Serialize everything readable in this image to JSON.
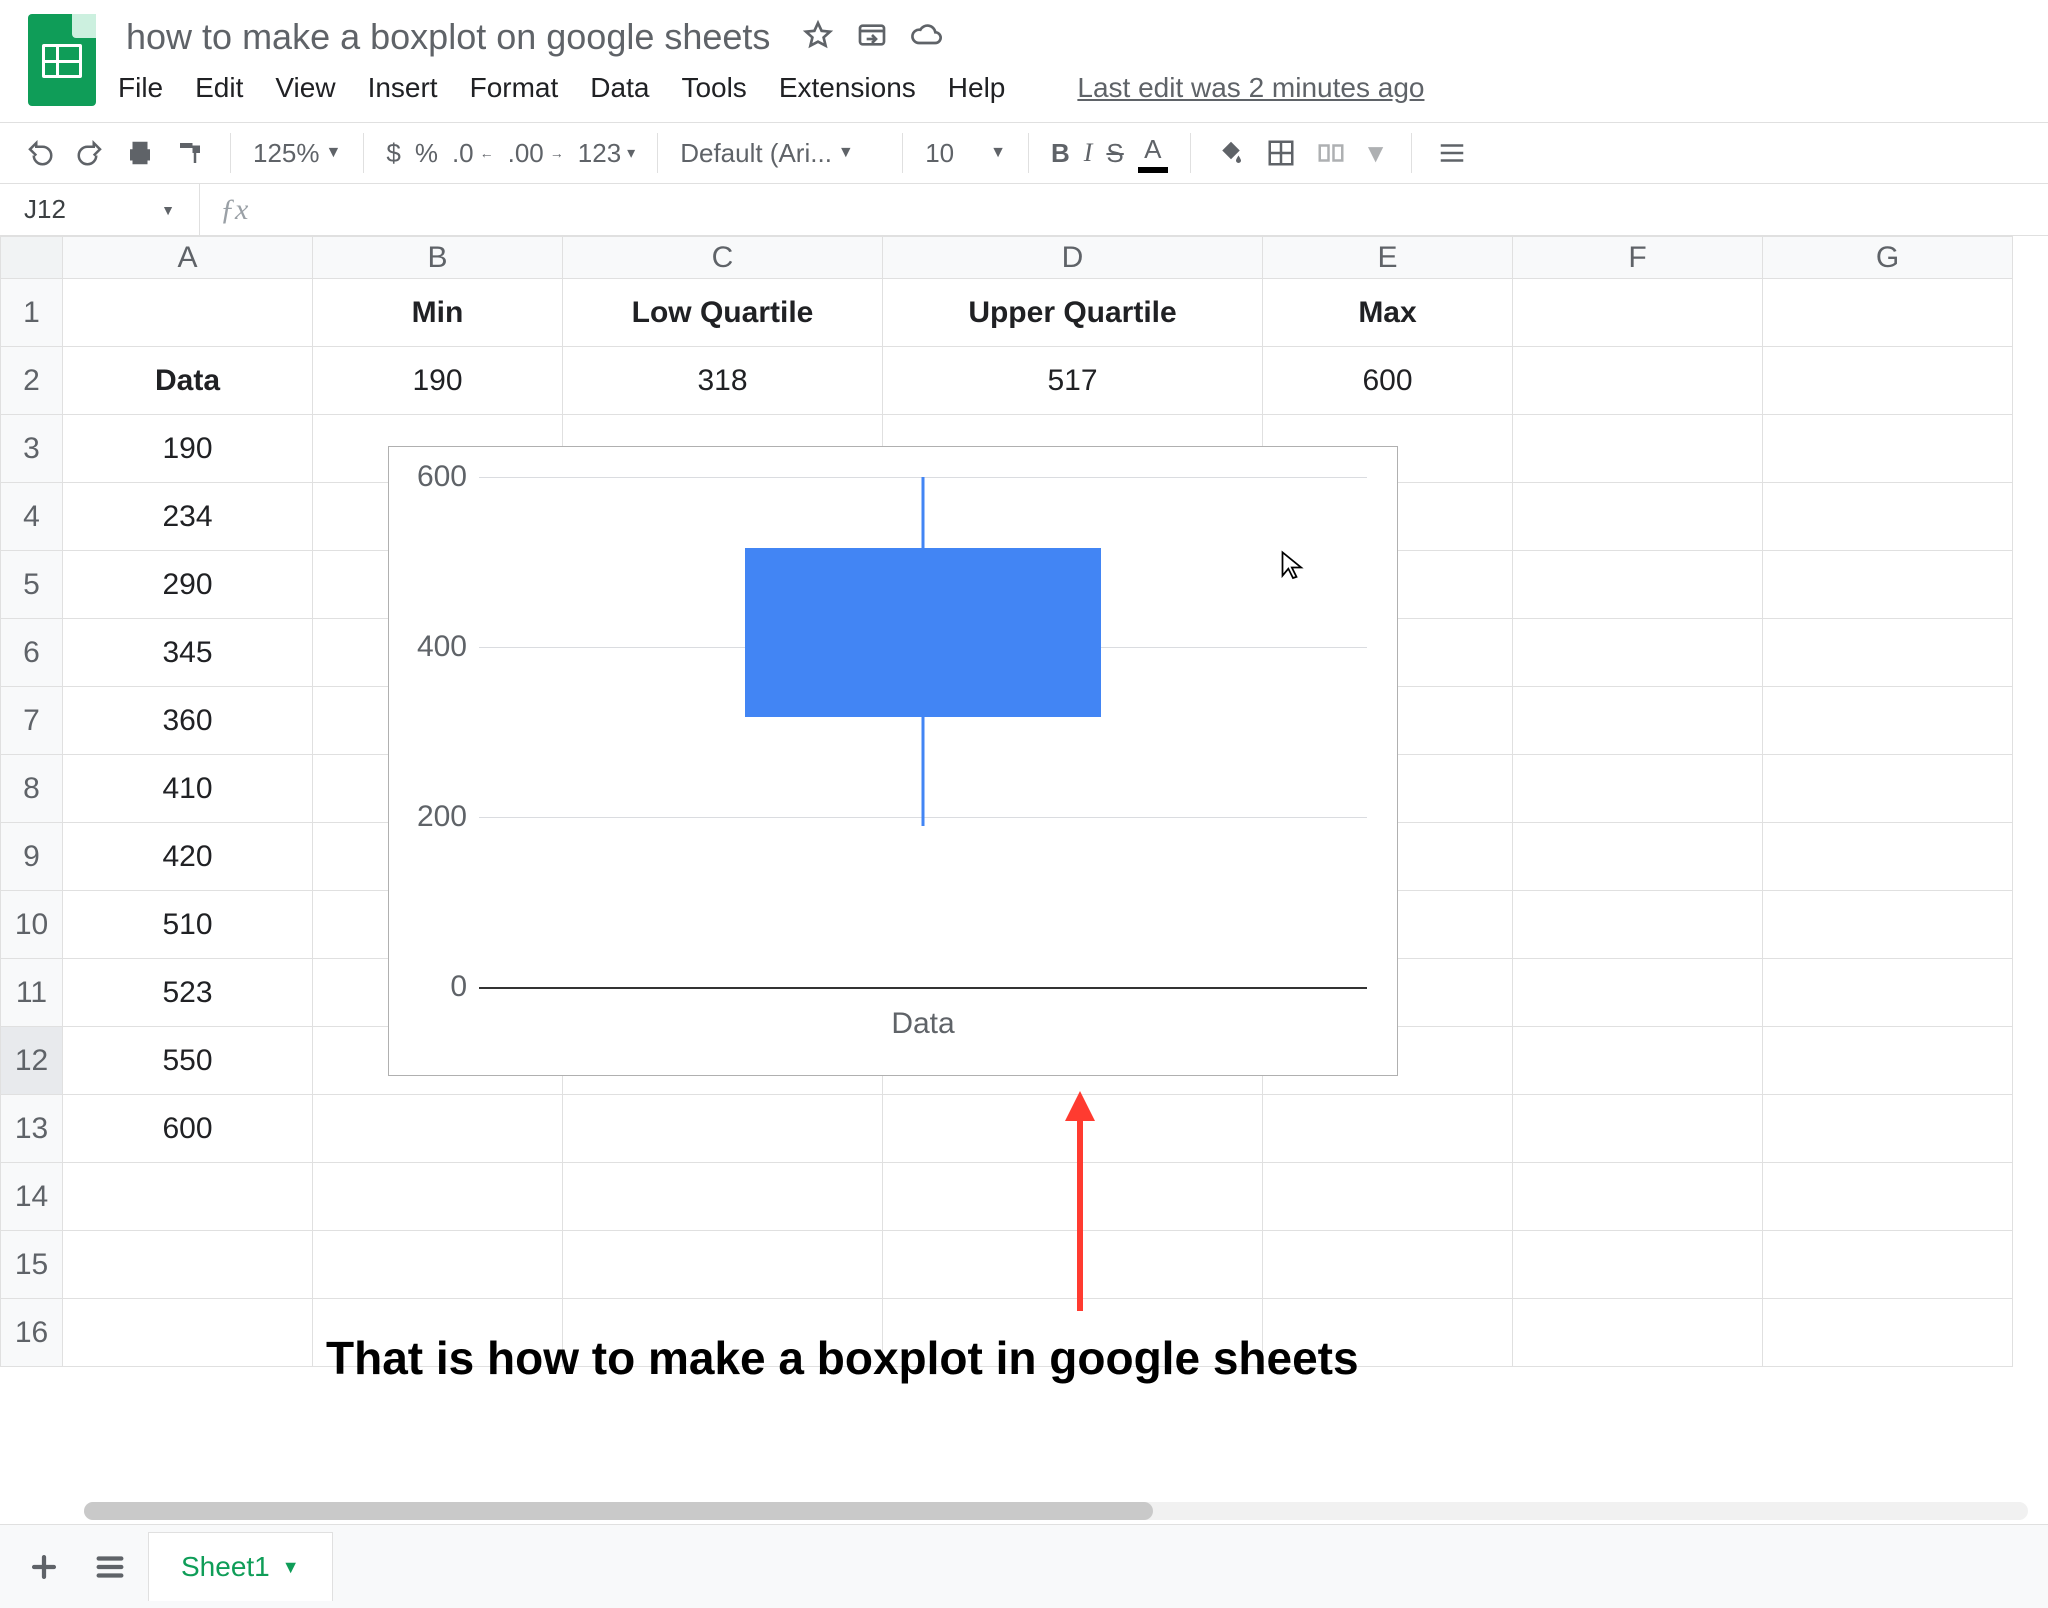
{
  "doc": {
    "title": "how to make a boxplot on google sheets",
    "last_edit": "Last edit was 2 minutes ago"
  },
  "menu": {
    "file": "File",
    "edit": "Edit",
    "view": "View",
    "insert": "Insert",
    "format": "Format",
    "data": "Data",
    "tools": "Tools",
    "extensions": "Extensions",
    "help": "Help"
  },
  "toolbar": {
    "zoom": "125%",
    "currency": "$",
    "percent": "%",
    "dec_dec": ".0",
    "dec_inc": ".00",
    "more_formats": "123",
    "font": "Default (Ari...",
    "font_size": "10"
  },
  "namebox": {
    "ref": "J12"
  },
  "columns": [
    "A",
    "B",
    "C",
    "D",
    "E",
    "F",
    "G"
  ],
  "row_numbers": [
    1,
    2,
    3,
    4,
    5,
    6,
    7,
    8,
    9,
    10,
    11,
    12,
    13,
    14,
    15,
    16
  ],
  "cells": {
    "headers_row1": {
      "B": "Min",
      "C": "Low Quartile",
      "D": "Upper Quartile",
      "E": "Max"
    },
    "row2": {
      "A": "Data",
      "B": "190",
      "C": "318",
      "D": "517",
      "E": "600"
    },
    "colA": {
      "3": "190",
      "4": "234",
      "5": "290",
      "6": "345",
      "7": "360",
      "8": "410",
      "9": "420",
      "10": "510",
      "11": "523",
      "12": "550",
      "13": "600"
    }
  },
  "chart_data": {
    "type": "boxplot",
    "xlabel": "Data",
    "ylim": [
      0,
      600
    ],
    "yticks": [
      0,
      200,
      400,
      600
    ],
    "series": [
      {
        "name": "Data",
        "min": 190,
        "q1": 318,
        "q3": 517,
        "max": 600
      }
    ]
  },
  "annotation": {
    "caption": "That is how to make a boxplot in google sheets"
  },
  "footer": {
    "sheet_name": "Sheet1"
  }
}
